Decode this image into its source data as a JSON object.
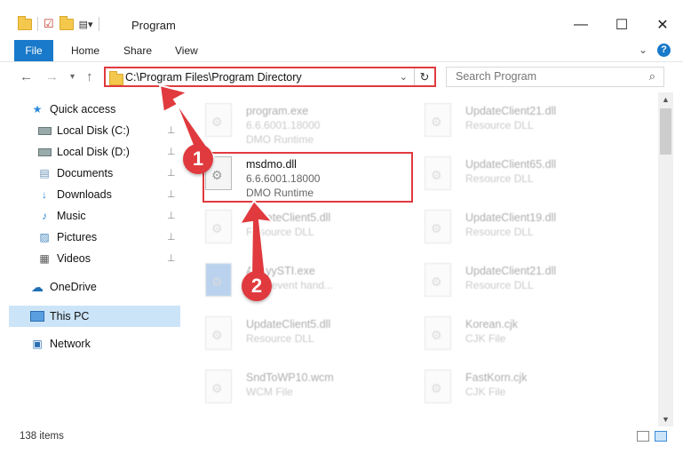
{
  "window": {
    "title": "Program"
  },
  "ribbon": {
    "tabs": [
      "File",
      "Home",
      "Share",
      "View"
    ]
  },
  "address": {
    "path": "C:\\Program Files\\Program Directory"
  },
  "search": {
    "placeholder": "Search Program"
  },
  "sidebar": {
    "items": [
      {
        "label": "Quick access",
        "icon": "star-icon"
      },
      {
        "label": "Local Disk (C:)",
        "icon": "drive-icon",
        "pinned": true
      },
      {
        "label": "Local Disk (D:)",
        "icon": "drive-icon",
        "pinned": true
      },
      {
        "label": "Documents",
        "icon": "documents-icon",
        "pinned": true
      },
      {
        "label": "Downloads",
        "icon": "download-icon",
        "pinned": true
      },
      {
        "label": "Music",
        "icon": "music-icon",
        "pinned": true
      },
      {
        "label": "Pictures",
        "icon": "pictures-icon",
        "pinned": true
      },
      {
        "label": "Videos",
        "icon": "videos-icon",
        "pinned": true
      },
      {
        "label": "OneDrive",
        "icon": "cloud-icon"
      },
      {
        "label": "This PC",
        "icon": "computer-icon",
        "selected": true
      },
      {
        "label": "Network",
        "icon": "network-icon"
      }
    ]
  },
  "files": [
    {
      "name": "program.exe",
      "line2": "6.6.6001.18000",
      "line3": "DMO Runtime",
      "faded": true
    },
    {
      "name": "UpdateClient21.dll",
      "line2": "Resource DLL",
      "faded": true
    },
    {
      "name": "msdmo.dll",
      "line2": "6.6.6001.18000",
      "line3": "DMO Runtime",
      "faded": false
    },
    {
      "name": "UpdateClient65.dll",
      "line2": "Resource DLL",
      "faded": true
    },
    {
      "name": "UpdateClient5.dll",
      "line2": "Resource DLL",
      "faded": true
    },
    {
      "name": "UpdateClient19.dll",
      "line2": "Resource DLL",
      "faded": true
    },
    {
      "name": "AbbyySTI.exe",
      "line2": "... sti event hand...",
      "faded": true
    },
    {
      "name": "UpdateClient21.dll",
      "line2": "Resource DLL",
      "faded": true
    },
    {
      "name": "UpdateClient5.dll",
      "line2": "Resource DLL",
      "faded": true
    },
    {
      "name": "Korean.cjk",
      "line2": "CJK File",
      "faded": true
    },
    {
      "name": "SndToWP10.wcm",
      "line2": "WCM File",
      "faded": true
    },
    {
      "name": "FastKorn.cjk",
      "line2": "CJK File",
      "faded": true
    }
  ],
  "status": {
    "count": "138 items"
  },
  "annotations": {
    "badge1": "1",
    "badge2": "2",
    "accent": "#e03a3e"
  }
}
